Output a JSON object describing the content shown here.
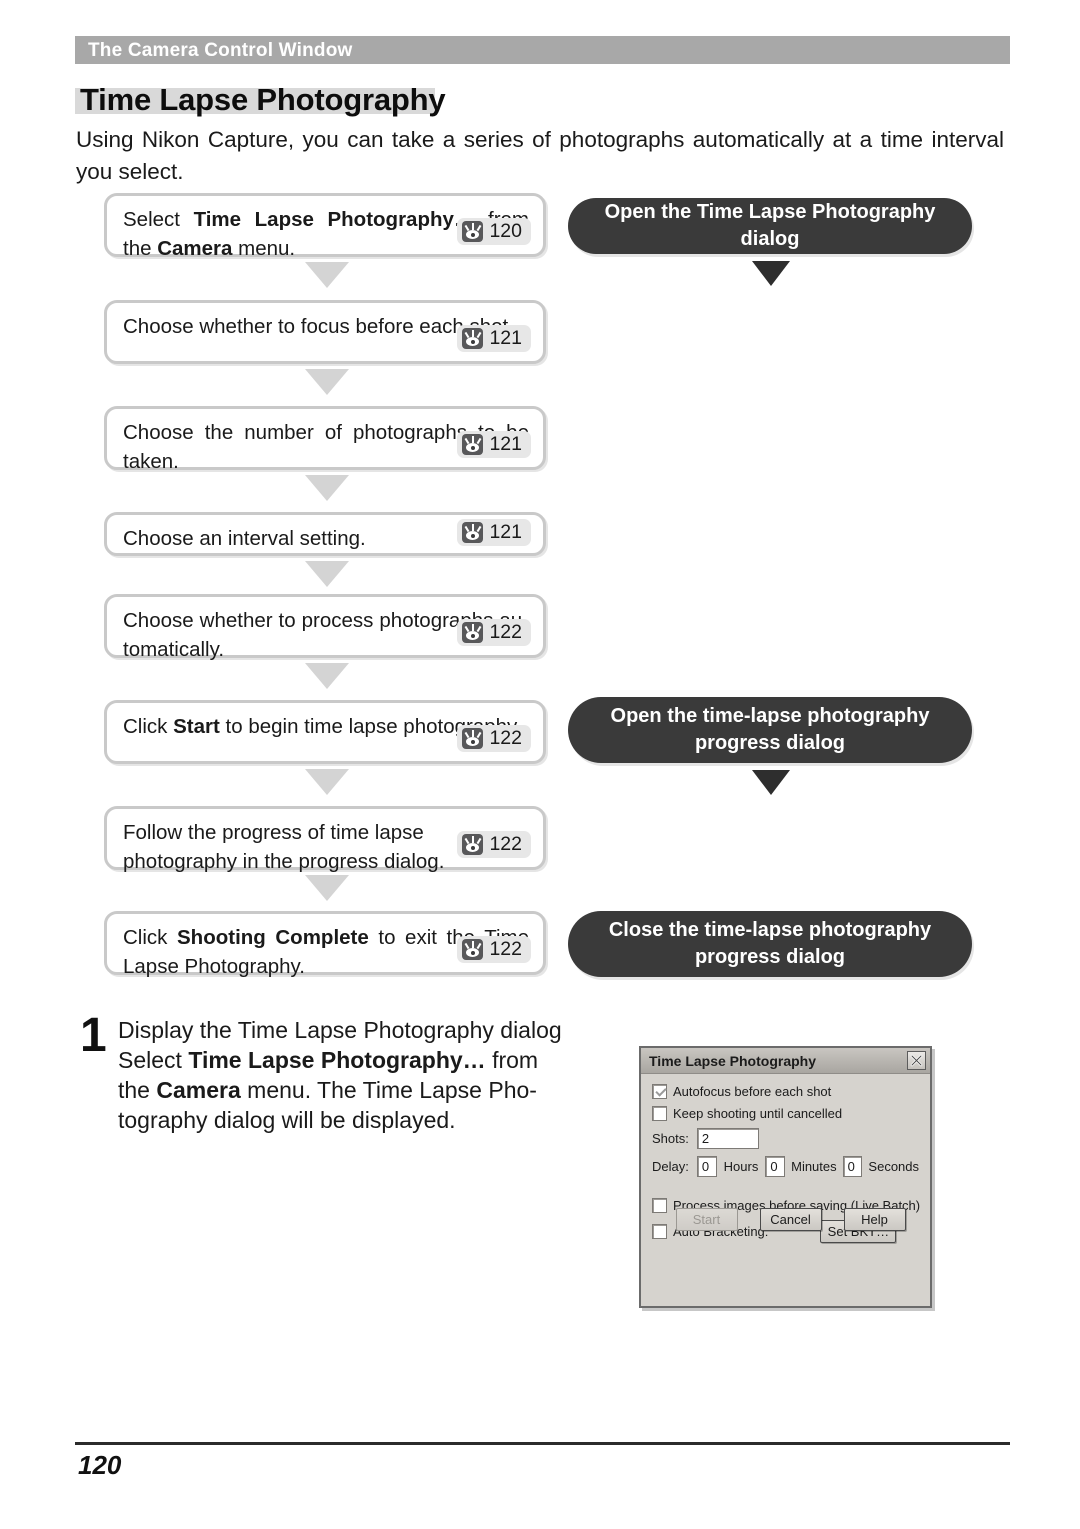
{
  "header": {
    "running_head": "The Camera Control Window"
  },
  "title": "Time Lapse Photography",
  "intro": {
    "line1": "Using Nikon Capture, you can take a series of photographs automatically at a time interval",
    "line2": "you select."
  },
  "flow_steps": [
    {
      "text_before": "Select ",
      "bold1": "Time Lapse Photography…",
      "text_mid": " from the ",
      "bold2": "Camera",
      "text_after": " menu.",
      "page_ref": "120",
      "icon": "eye-page-reference-icon"
    },
    {
      "text": "Choose whether to focus before each shot.",
      "page_ref": "121",
      "icon": "eye-page-reference-icon"
    },
    {
      "text": "Choose the number of photographs to be taken.",
      "page_ref": "121",
      "icon": "eye-page-reference-icon"
    },
    {
      "text": "Choose an interval setting.",
      "page_ref": "121",
      "icon": "eye-page-reference-icon"
    },
    {
      "text": "Choose whether to process photographs au-tomatically.",
      "page_ref": "122",
      "icon": "eye-page-reference-icon"
    },
    {
      "text_before": "Click ",
      "bold1": "Start",
      "text_after": " to begin time lapse photography.",
      "page_ref": "122",
      "icon": "eye-page-reference-icon"
    },
    {
      "text": "Follow the progress of time lapse photography in the progress dialog.",
      "page_ref": "122",
      "icon": "eye-page-reference-icon"
    },
    {
      "text_before": "Click ",
      "bold1": "Shooting Complete",
      "text_after": " to exit the Time Lapse Photography.",
      "page_ref": "122",
      "icon": "eye-page-reference-icon"
    }
  ],
  "callouts": [
    {
      "line1": "Open the Time Lapse Photography dialog",
      "line2": ""
    },
    {
      "line1": "Open the time-lapse photography",
      "line2": "progress dialog"
    },
    {
      "line1": "Close the time-lapse photography",
      "line2": "progress dialog"
    }
  ],
  "step": {
    "number": "1",
    "heading": "Display the Time Lapse Photography dialog",
    "line2_a": "Select ",
    "line2_b": "Time Lapse Photography…",
    "line2_c": " from",
    "line3_a": "the ",
    "line3_b": "Camera",
    "line3_c": " menu.  The Time Lapse Pho-",
    "line4": "tography dialog will be displayed."
  },
  "dialog": {
    "title": "Time Lapse Photography",
    "close_label": "close-button",
    "checkbox_autofocus": "Autofocus before each shot",
    "checkbox_keep_shooting": "Keep shooting until cancelled",
    "shots_label": "Shots:",
    "shots_value": "2",
    "delay_label": "Delay:",
    "hours_value": "0",
    "hours_label": "Hours",
    "minutes_value": "0",
    "minutes_label": "Minutes",
    "seconds_value": "0",
    "seconds_label": "Seconds",
    "checkbox_process": "Process images before saving (Live Batch)",
    "checkbox_bracketing": "Auto Bracketing:",
    "set_bkt_button": "Set BKT…",
    "start_button": "Start",
    "cancel_button": "Cancel",
    "help_button": "Help"
  },
  "footer": {
    "page_number": "120"
  },
  "colors": {
    "header_band": "#a8a8a8",
    "title_highlight": "#d9d9d9",
    "box_border": "#c9c9c9",
    "callout_bg": "#3a3a3a",
    "arrow_light": "#d4d4d4",
    "dialog_bg": "#d6d3ce"
  }
}
